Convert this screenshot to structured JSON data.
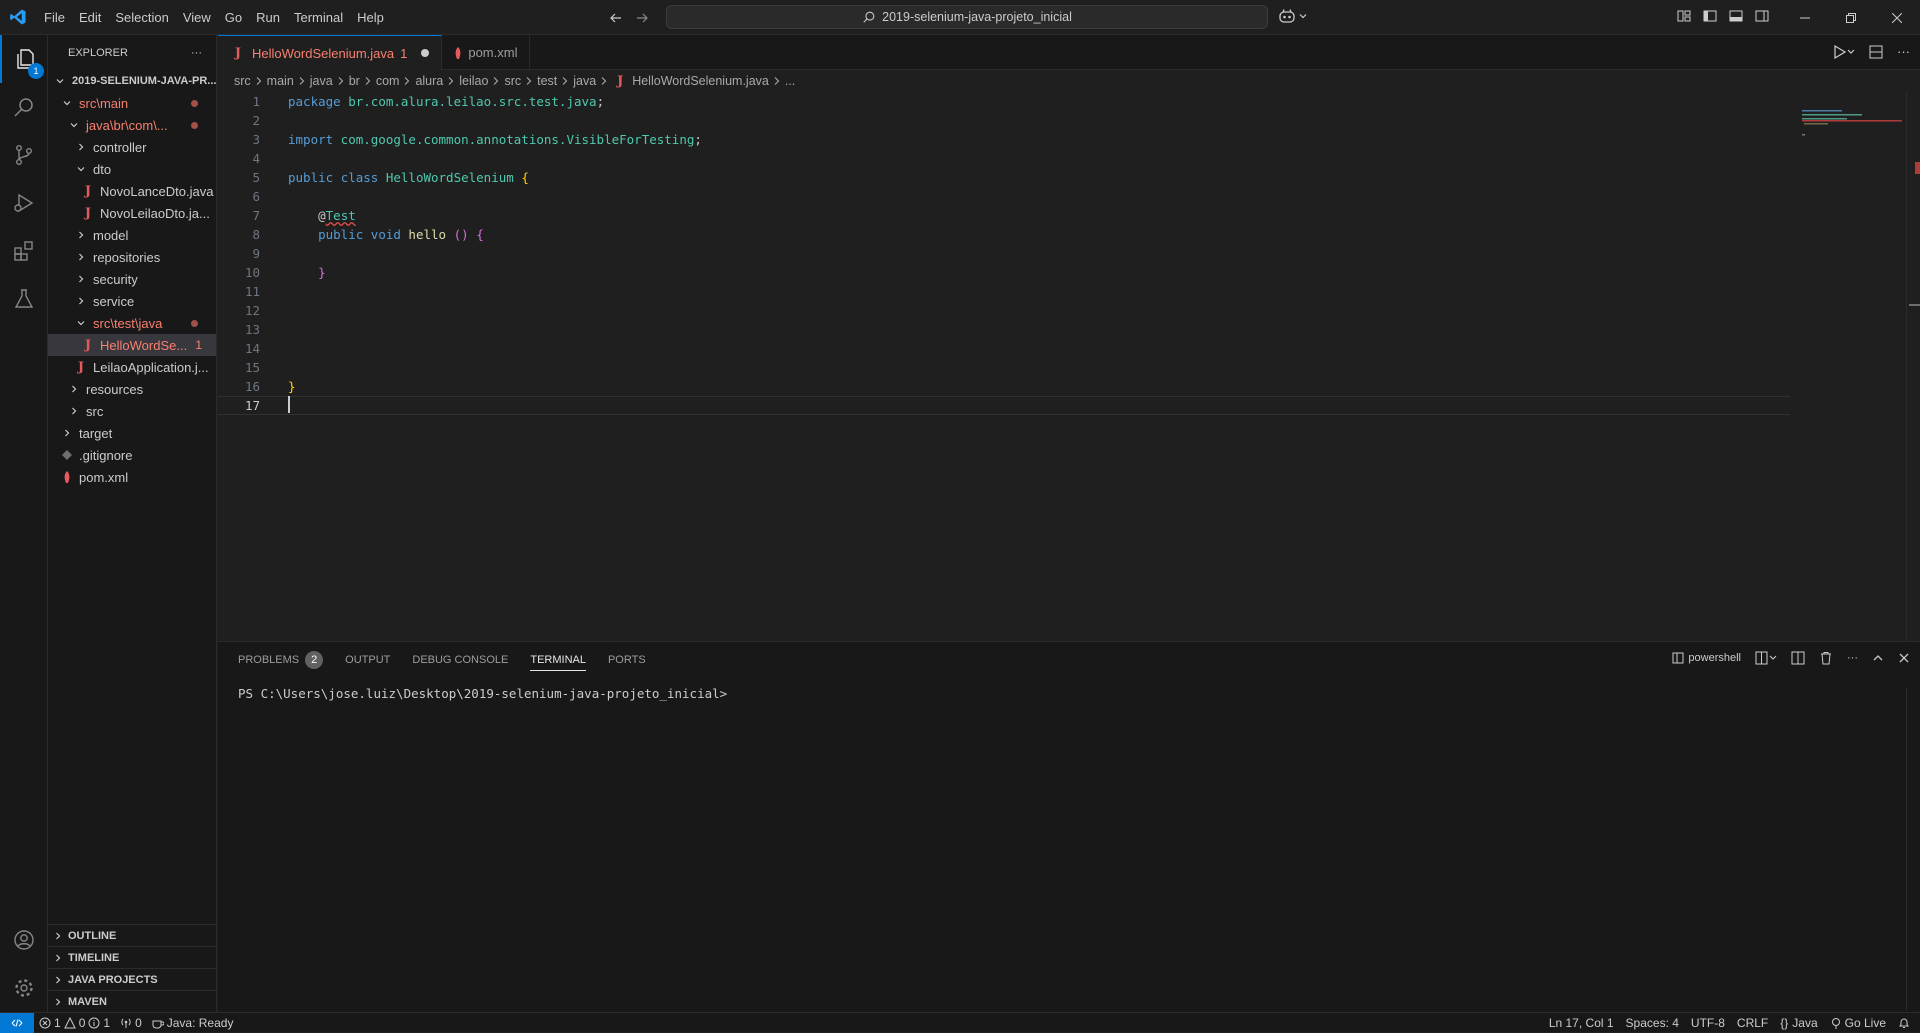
{
  "titlebar": {
    "menu": [
      "File",
      "Edit",
      "Selection",
      "View",
      "Go",
      "Run",
      "Terminal",
      "Help"
    ],
    "search_text": "2019-selenium-java-projeto_inicial"
  },
  "activitybar": {
    "explorer_badge": "1"
  },
  "sidebar": {
    "header": "EXPLORER",
    "tree": [
      {
        "label": "2019-SELENIUM-JAVA-PR...",
        "indent": 0,
        "chev": "down",
        "kind": "root"
      },
      {
        "label": "src\\main",
        "indent": 1,
        "chev": "down",
        "kind": "err",
        "dot": true
      },
      {
        "label": "java\\br\\com\\...",
        "indent": 2,
        "chev": "down",
        "kind": "err",
        "dot": true
      },
      {
        "label": "controller",
        "indent": 3,
        "chev": "right",
        "kind": "folder"
      },
      {
        "label": "dto",
        "indent": 3,
        "chev": "down",
        "kind": "folder"
      },
      {
        "label": "NovoLanceDto.java",
        "indent": 4,
        "chev": "",
        "kind": "java"
      },
      {
        "label": "NovoLeilaoDto.ja...",
        "indent": 4,
        "chev": "",
        "kind": "java"
      },
      {
        "label": "model",
        "indent": 3,
        "chev": "right",
        "kind": "folder"
      },
      {
        "label": "repositories",
        "indent": 3,
        "chev": "right",
        "kind": "folder"
      },
      {
        "label": "security",
        "indent": 3,
        "chev": "right",
        "kind": "folder"
      },
      {
        "label": "service",
        "indent": 3,
        "chev": "right",
        "kind": "folder"
      },
      {
        "label": "src\\test\\java",
        "indent": 3,
        "chev": "down",
        "kind": "err",
        "dot": true
      },
      {
        "label": "HelloWordSe...",
        "indent": 4,
        "chev": "",
        "kind": "java-err",
        "count": "1",
        "selected": true
      },
      {
        "label": "LeilaoApplication.j...",
        "indent": 3,
        "chev": "",
        "kind": "java"
      },
      {
        "label": "resources",
        "indent": 2,
        "chev": "right",
        "kind": "folder"
      },
      {
        "label": "src",
        "indent": 2,
        "chev": "right",
        "kind": "folder"
      },
      {
        "label": "target",
        "indent": 1,
        "chev": "right",
        "kind": "folder"
      },
      {
        "label": ".gitignore",
        "indent": 1,
        "chev": "",
        "kind": "git"
      },
      {
        "label": "pom.xml",
        "indent": 1,
        "chev": "",
        "kind": "xml"
      }
    ],
    "sections": [
      "OUTLINE",
      "TIMELINE",
      "JAVA PROJECTS",
      "MAVEN"
    ]
  },
  "editor": {
    "tabs": [
      {
        "label": "HelloWordSelenium.java",
        "count": "1",
        "active": true
      },
      {
        "label": "pom.xml",
        "active": false
      }
    ],
    "breadcrumb": [
      "src",
      "main",
      "java",
      "br",
      "com",
      "alura",
      "leilao",
      "src",
      "test",
      "java",
      "HelloWordSelenium.java",
      "..."
    ],
    "lines": [
      {
        "n": "1",
        "tokens": [
          {
            "t": "package",
            "c": "kw"
          },
          {
            "t": " br.com.alura.leilao.src.test.java",
            "c": "pkg"
          },
          {
            "t": ";",
            "c": "plain"
          }
        ]
      },
      {
        "n": "2",
        "tokens": []
      },
      {
        "n": "3",
        "tokens": [
          {
            "t": "import",
            "c": "kw"
          },
          {
            "t": " com.google.common.annotations.VisibleForTesting",
            "c": "pkg"
          },
          {
            "t": ";",
            "c": "plain"
          }
        ]
      },
      {
        "n": "4",
        "tokens": []
      },
      {
        "n": "5",
        "tokens": [
          {
            "t": "public",
            "c": "kw"
          },
          {
            "t": " ",
            "c": "plain"
          },
          {
            "t": "class",
            "c": "kw"
          },
          {
            "t": " HelloWordSelenium",
            "c": "cls"
          },
          {
            "t": " ",
            "c": "plain"
          },
          {
            "t": "{",
            "c": "br1"
          }
        ]
      },
      {
        "n": "6",
        "tokens": []
      },
      {
        "n": "7",
        "tokens": [
          {
            "t": "    ",
            "c": "plain"
          },
          {
            "t": "@",
            "c": "plain"
          },
          {
            "t": "Test",
            "c": "ann"
          }
        ]
      },
      {
        "n": "8",
        "tokens": [
          {
            "t": "    ",
            "c": "plain"
          },
          {
            "t": "public",
            "c": "kw"
          },
          {
            "t": " ",
            "c": "plain"
          },
          {
            "t": "void",
            "c": "kw"
          },
          {
            "t": " hello",
            "c": "fn"
          },
          {
            "t": " ",
            "c": "plain"
          },
          {
            "t": "()",
            "c": "br2"
          },
          {
            "t": " ",
            "c": "plain"
          },
          {
            "t": "{",
            "c": "br2"
          }
        ]
      },
      {
        "n": "9",
        "tokens": []
      },
      {
        "n": "10",
        "tokens": [
          {
            "t": "    ",
            "c": "plain"
          },
          {
            "t": "}",
            "c": "br2"
          }
        ]
      },
      {
        "n": "11",
        "tokens": []
      },
      {
        "n": "12",
        "tokens": []
      },
      {
        "n": "13",
        "tokens": []
      },
      {
        "n": "14",
        "tokens": []
      },
      {
        "n": "15",
        "tokens": []
      },
      {
        "n": "16",
        "tokens": [
          {
            "t": "}",
            "c": "br1"
          }
        ]
      },
      {
        "n": "17",
        "tokens": [],
        "current": true
      }
    ]
  },
  "panel": {
    "tabs": [
      {
        "label": "PROBLEMS",
        "count": "2"
      },
      {
        "label": "OUTPUT"
      },
      {
        "label": "DEBUG CONSOLE"
      },
      {
        "label": "TERMINAL",
        "active": true
      },
      {
        "label": "PORTS"
      }
    ],
    "shell": "powershell",
    "terminal_line": "PS C:\\Users\\jose.luiz\\Desktop\\2019-selenium-java-projeto_inicial>"
  },
  "statusbar": {
    "errors": "1",
    "warnings": "0",
    "infos": "1",
    "ports": "0",
    "java_status": "Java: Ready",
    "position": "Ln 17, Col 1",
    "spaces": "Spaces: 4",
    "encoding": "UTF-8",
    "eol": "CRLF",
    "language": "Java",
    "golive": "Go Live"
  },
  "colors": {
    "accent": "#0078d4",
    "error": "#f88070",
    "background": "#1f1f1f"
  }
}
